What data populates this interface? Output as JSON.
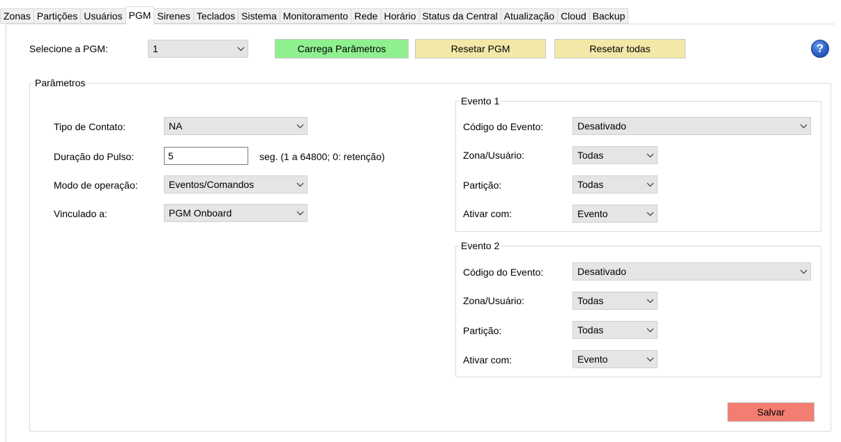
{
  "tabs": [
    {
      "label": "Zonas",
      "active": false
    },
    {
      "label": "Partições",
      "active": false
    },
    {
      "label": "Usuários",
      "active": false
    },
    {
      "label": "PGM",
      "active": true
    },
    {
      "label": "Sirenes",
      "active": false
    },
    {
      "label": "Teclados",
      "active": false
    },
    {
      "label": "Sistema",
      "active": false
    },
    {
      "label": "Monitoramento",
      "active": false
    },
    {
      "label": "Rede",
      "active": false
    },
    {
      "label": "Horário",
      "active": false
    },
    {
      "label": "Status da Central",
      "active": false
    },
    {
      "label": "Atualização",
      "active": false
    },
    {
      "label": "Cloud",
      "active": false
    },
    {
      "label": "Backup",
      "active": false
    }
  ],
  "top": {
    "select_label": "Selecione a PGM:",
    "select_value": "1",
    "load_button": "Carrega Parâmetros",
    "reset_button": "Resetar PGM",
    "reset_all_button": "Resetar todas",
    "help_glyph": "?"
  },
  "params": {
    "legend": "Parâmetros",
    "contact_type_label": "Tipo de Contato:",
    "contact_type_value": "NA",
    "pulse_label": "Duração do Pulso:",
    "pulse_value": "5",
    "pulse_hint": "seg. (1 a 64800; 0: retenção)",
    "mode_label": "Modo de operação:",
    "mode_value": "Eventos/Comandos",
    "linked_label": "Vinculado a:",
    "linked_value": "PGM Onboard"
  },
  "event1": {
    "legend": "Evento 1",
    "code_label": "Código do Evento:",
    "code_value": "Desativado",
    "zone_label": "Zona/Usuário:",
    "zone_value": "Todas",
    "partition_label": "Partição:",
    "partition_value": "Todas",
    "activate_label": "Ativar com:",
    "activate_value": "Evento"
  },
  "event2": {
    "legend": "Evento 2",
    "code_label": "Código do Evento:",
    "code_value": "Desativado",
    "zone_label": "Zona/Usuário:",
    "zone_value": "Todas",
    "partition_label": "Partição:",
    "partition_value": "Todas",
    "activate_label": "Ativar com:",
    "activate_value": "Evento"
  },
  "save_button": "Salvar",
  "colors": {
    "load_button": "#8ff08f",
    "reset_buttons": "#f3e8a8",
    "save_button": "#f47d72",
    "combo_bg": "#e5e5e5"
  }
}
